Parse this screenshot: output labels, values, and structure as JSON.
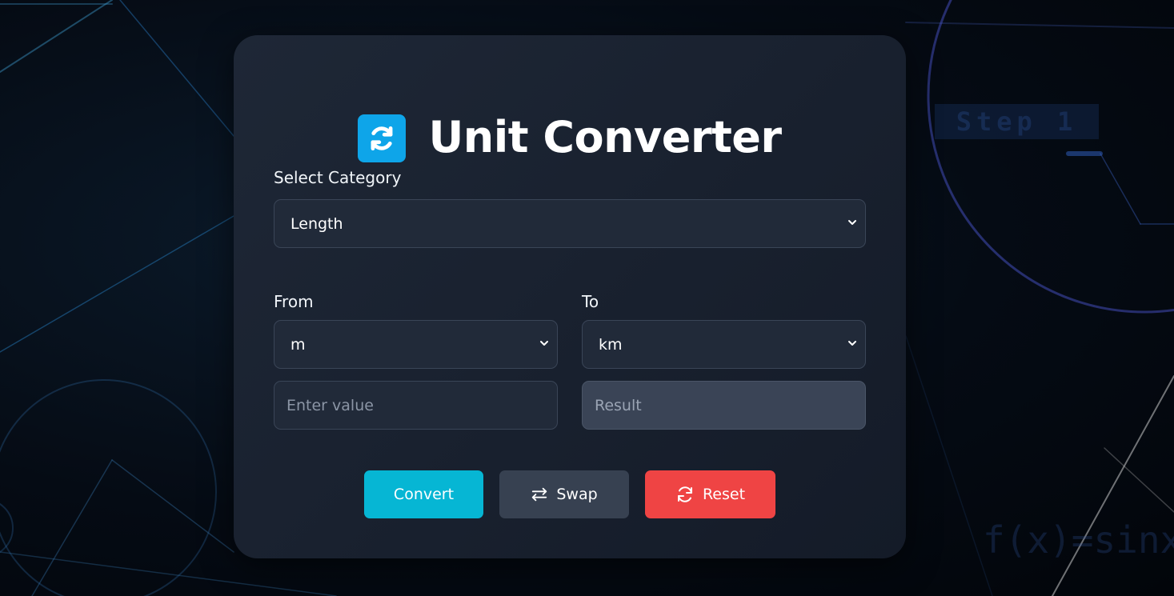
{
  "app": {
    "title": "Unit Converter",
    "logo_icon": "refresh-arrows-icon",
    "accent_color": "#0ea5e9"
  },
  "background": {
    "step_text": "Step 1",
    "formula_text": "f(x)=sinx"
  },
  "category": {
    "label": "Select Category",
    "selected": "Length"
  },
  "from": {
    "label": "From",
    "unit": "m",
    "value_placeholder": "Enter value"
  },
  "to": {
    "label": "To",
    "unit": "km",
    "result_placeholder": "Result"
  },
  "buttons": {
    "convert": {
      "label": "Convert",
      "color": "#06b6d4"
    },
    "swap": {
      "label": "Swap",
      "icon": "swap-arrows-icon",
      "color": "#374151"
    },
    "reset": {
      "label": "Reset",
      "icon": "refresh-icon",
      "color": "#ef4444"
    }
  }
}
